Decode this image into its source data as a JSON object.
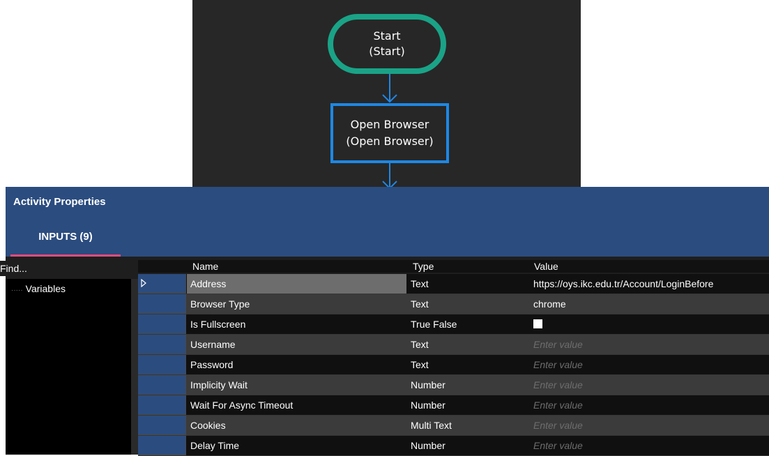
{
  "flow": {
    "start_node": {
      "line1": "Start",
      "line2": "(Start)"
    },
    "browser_node": {
      "line1": "Open Browser",
      "line2": "(Open Browser)"
    }
  },
  "panel": {
    "title": "Activity Properties",
    "tab": "INPUTS (9)",
    "find_placeholder": "Find...",
    "tree_item": "Variables",
    "columns": {
      "name": "Name",
      "type": "Type",
      "value": "Value"
    },
    "rows": [
      {
        "name": "Address",
        "type": "Text",
        "value": "https://oys.ikc.edu.tr/Account/LoginBefore"
      },
      {
        "name": "Browser Type",
        "type": "Text",
        "value": "chrome"
      },
      {
        "name": "Is Fullscreen",
        "type": "True False",
        "value": ""
      },
      {
        "name": "Username",
        "type": "Text",
        "value": "Enter value"
      },
      {
        "name": "Password",
        "type": "Text",
        "value": "Enter value"
      },
      {
        "name": "Implicity Wait",
        "type": "Number",
        "value": "Enter value"
      },
      {
        "name": "Wait For Async Timeout",
        "type": "Number",
        "value": "Enter value"
      },
      {
        "name": "Cookies",
        "type": "Multi Text",
        "value": "Enter value"
      },
      {
        "name": "Delay Time",
        "type": "Number",
        "value": "Enter value"
      }
    ]
  },
  "colors": {
    "canvas_bg": "#272727",
    "start_border": "#1aa387",
    "browser_border": "#1e88e5",
    "header_bg": "#2b4c7f",
    "tab_underline": "#e84b7d"
  }
}
